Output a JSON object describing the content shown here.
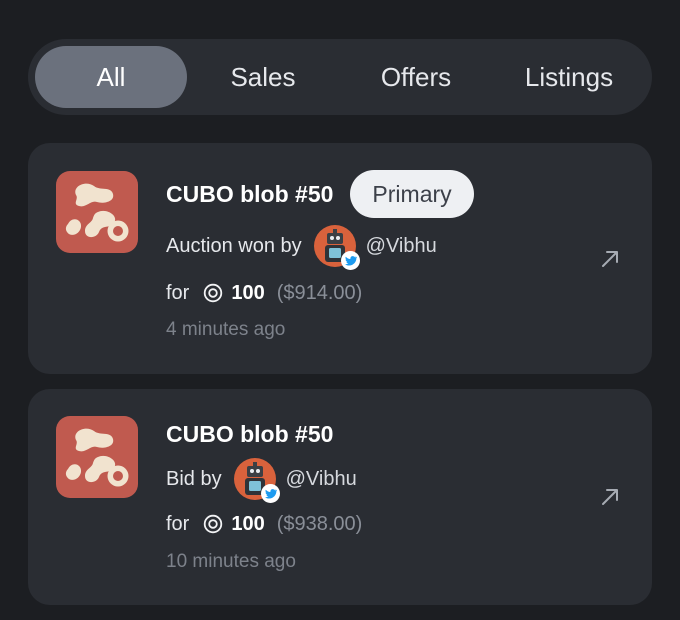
{
  "tabs": [
    {
      "label": "All",
      "active": true
    },
    {
      "label": "Sales",
      "active": false
    },
    {
      "label": "Offers",
      "active": false
    },
    {
      "label": "Listings",
      "active": false
    }
  ],
  "activity": [
    {
      "title": "CUBO blob #50",
      "badge": "Primary",
      "action_text": "Auction won by",
      "user_handle": "@Vibhu",
      "for_label": "for",
      "amount": "100",
      "fiat": "($914.00)",
      "time": "4 minutes ago"
    },
    {
      "title": "CUBO blob #50",
      "action_text": "Bid by",
      "user_handle": "@Vibhu",
      "for_label": "for",
      "amount": "100",
      "fiat": "($938.00)",
      "time": "10 minutes ago"
    }
  ],
  "icons": {
    "thumbnail": "blob-art-icon",
    "currency": "currency-icon",
    "social": "twitter-icon",
    "open": "external-link-icon"
  },
  "colors": {
    "background": "#1c1e22",
    "card": "#2a2d33",
    "active_tab": "#6b717d",
    "thumbnail_bg": "#c05a4f",
    "muted_text": "#7d828b"
  }
}
